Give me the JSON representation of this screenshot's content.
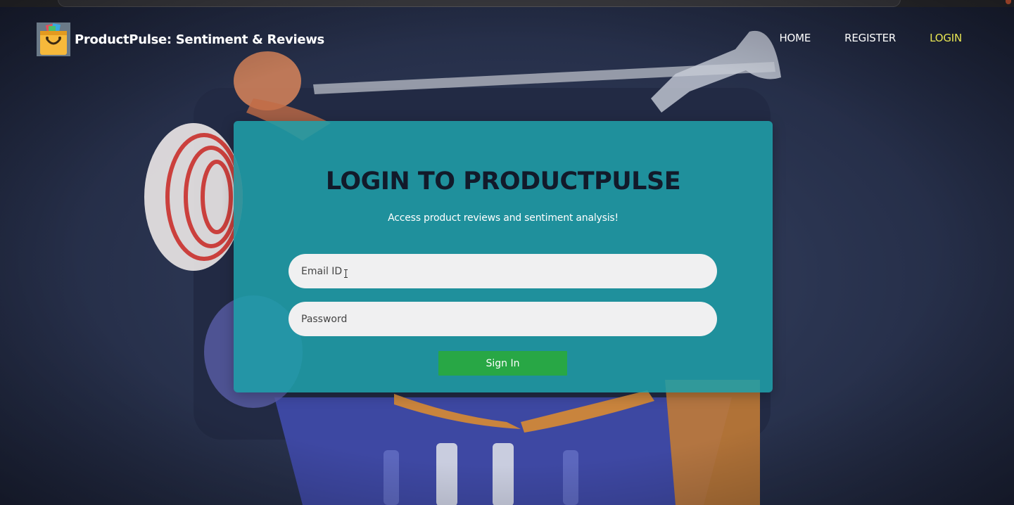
{
  "brand": {
    "title": "ProductPulse: Sentiment & Reviews",
    "logo_icon": "shopping-bag-icon"
  },
  "nav": {
    "home": "HOME",
    "register": "REGISTER",
    "login": "LOGIN",
    "active": "login"
  },
  "login": {
    "title": "LOGIN TO PRODUCTPULSE",
    "subtitle": "Access product reviews and sentiment analysis!",
    "email_placeholder": "Email ID",
    "password_placeholder": "Password",
    "submit_label": "Sign In"
  },
  "colors": {
    "card": "#1f9ea8",
    "nav_active": "#e7e552",
    "button": "#28a745",
    "title": "#121a2a"
  }
}
